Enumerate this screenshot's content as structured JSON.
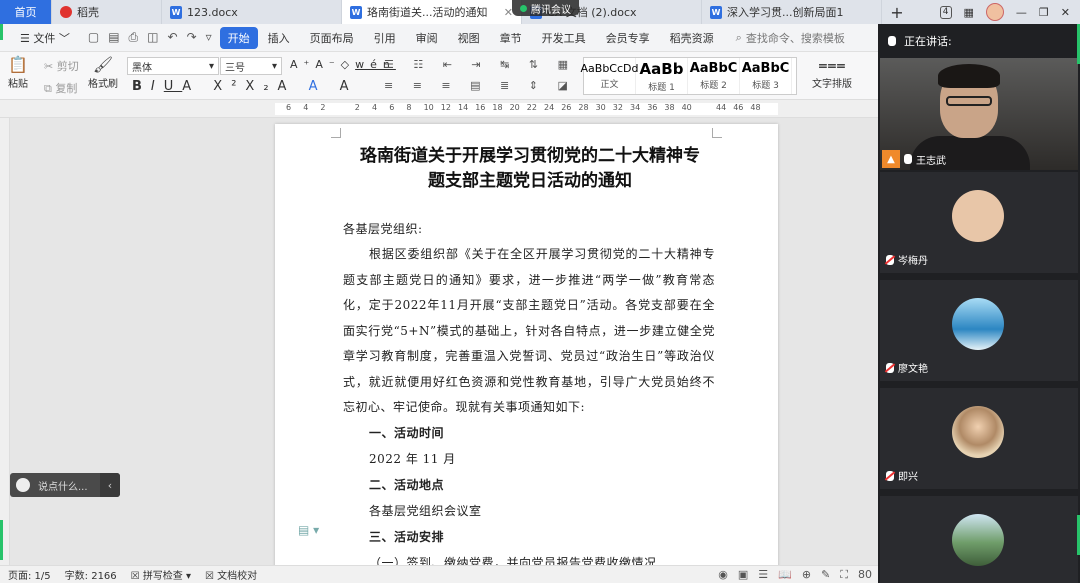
{
  "tabs": [
    {
      "label": "首页",
      "type": "home"
    },
    {
      "label": "稻壳",
      "type": "daoke"
    },
    {
      "label": "123.docx",
      "type": "doc"
    },
    {
      "label": "珞南街道关...活动的通知",
      "type": "doc",
      "active": true
    },
    {
      "label": "腾讯会议",
      "type": "meeting"
    },
    {
      "label": "CX 文档 (2).docx",
      "type": "doc"
    },
    {
      "label": "深入学习贯...创新局面1",
      "type": "doc"
    }
  ],
  "tab_right": {
    "badge": "4"
  },
  "menubar": {
    "file": "文件",
    "items": [
      "开始",
      "插入",
      "页面布局",
      "引用",
      "审阅",
      "视图",
      "章节",
      "开发工具",
      "会员专享",
      "稻壳资源"
    ],
    "search": "查找命令、搜索模板"
  },
  "ribbon": {
    "paste": "粘贴",
    "cut": "剪切",
    "copy": "复制",
    "format_painter": "格式刷",
    "font": "黑体",
    "size": "三号",
    "styles": [
      {
        "sample": "AaBbCcDd",
        "name": "正文"
      },
      {
        "sample": "AaBb",
        "name": "标题 1"
      },
      {
        "sample": "AaBbC",
        "name": "标题 2"
      },
      {
        "sample": "AaBbC",
        "name": "标题 3"
      }
    ],
    "text_layout": "文字排版"
  },
  "ruler": [
    "6",
    "4",
    "2",
    "",
    "2",
    "4",
    "6",
    "8",
    "10",
    "12",
    "14",
    "16",
    "18",
    "20",
    "22",
    "24",
    "26",
    "28",
    "30",
    "32",
    "34",
    "36",
    "38",
    "40",
    "",
    "44",
    "46",
    "48"
  ],
  "document": {
    "title_line1": "珞南街道关于开展学习贯彻党的二十大精神专",
    "title_line2": "题支部主题党日活动的通知",
    "salutation": "各基层党组织:",
    "body": "根据区委组织部《关于在全区开展学习贯彻党的二十大精神专题支部主题党日的通知》要求，进一步推进“两学一做”教育常态化，定于2022年11月开展“支部主题党日”活动。各党支部要在全面实行党“5+N”模式的基础上，针对各自特点，进一步建立健全党章学习教育制度，完善重温入党誓词、党员过“政治生日”等政治仪式，就近就便用好红色资源和党性教育基地，引导广大党员始终不忘初心、牢记使命。现就有关事项通知如下:",
    "h1": "一、活动时间",
    "time": "2022 年 11 月",
    "h2": "二、活动地点",
    "place": "各基层党组织会议室",
    "h3": "三、活动安排",
    "item1": "（一）签到、缴纳党费，并向党员报告党费收缴情况"
  },
  "speak_box": "说点什么...",
  "statusbar": {
    "page": "页面: 1/5",
    "words": "字数: 2166",
    "spell": "拼写检查",
    "proof": "文档校对",
    "zoom": "80"
  },
  "meeting": {
    "speaking_label": "正在讲话:",
    "participants": [
      {
        "name": "王志武",
        "video": true,
        "host": true
      },
      {
        "name": "岑梅丹",
        "color": "#e8c6a8"
      },
      {
        "name": "廖文艳",
        "color": "#4aa6d8"
      },
      {
        "name": "即兴",
        "color": "#e6d2b2"
      },
      {
        "name": "",
        "color": "#6f9d6a"
      }
    ]
  }
}
